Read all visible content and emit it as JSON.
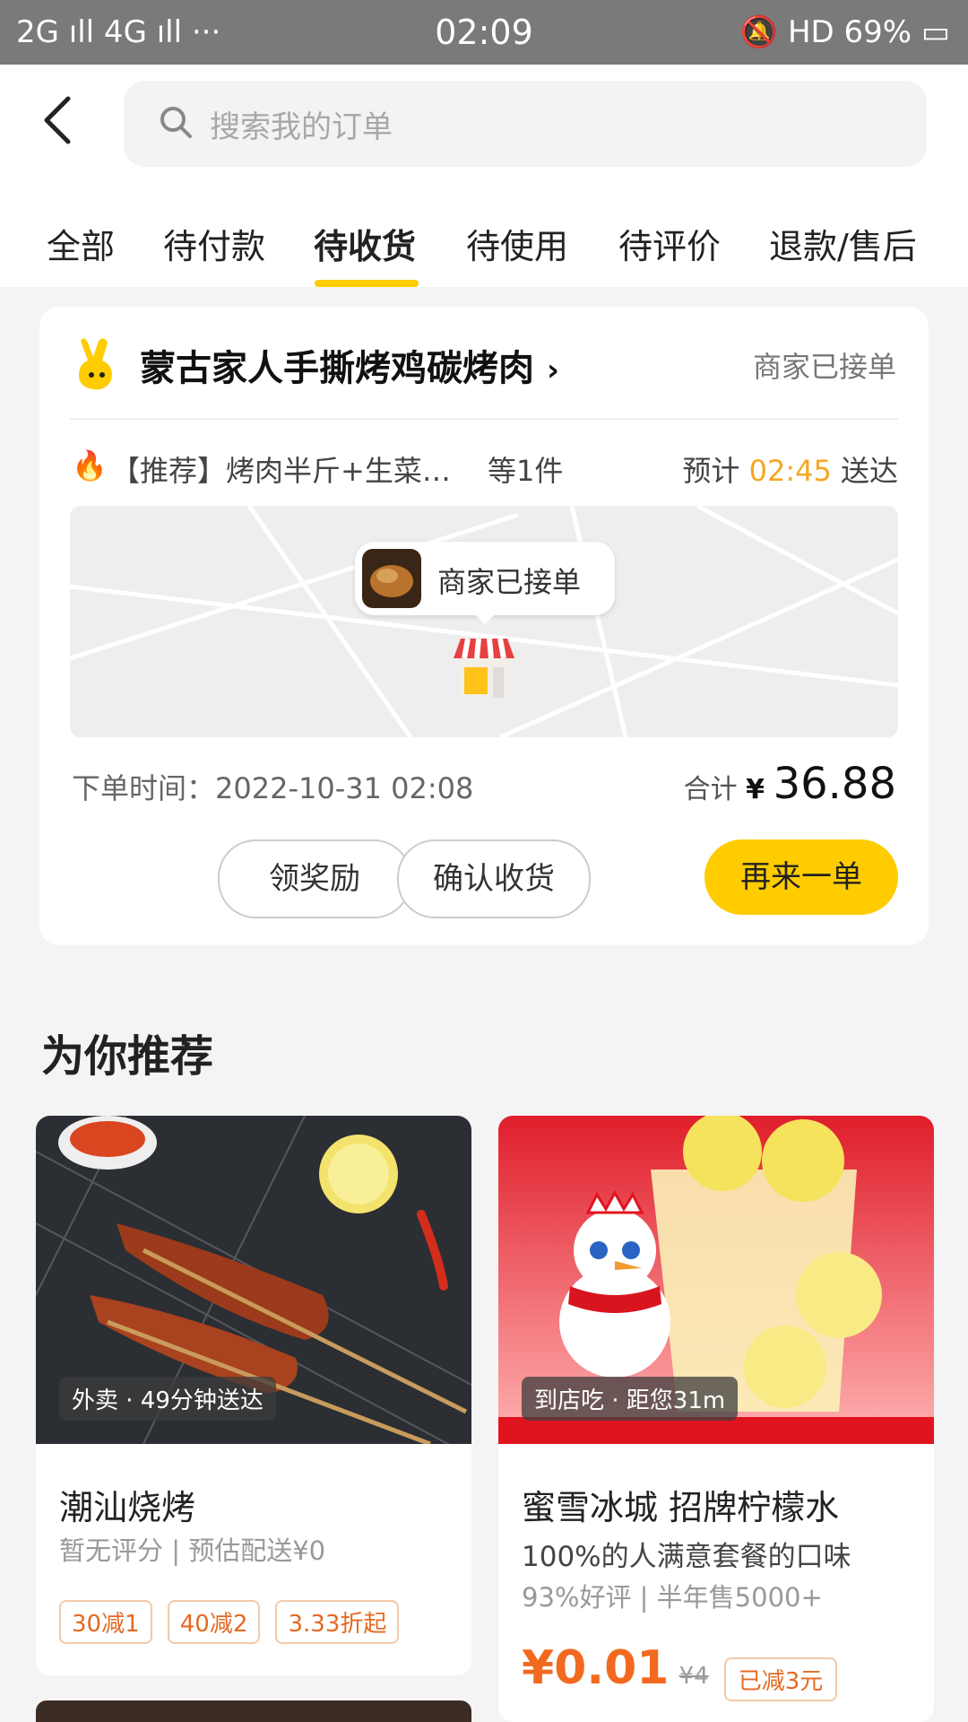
{
  "status_bar": {
    "left": "2G ıll 4G ıll ···",
    "time": "02:09",
    "right": "HD 69%"
  },
  "search": {
    "placeholder": "搜索我的订单"
  },
  "tabs": [
    {
      "label": "全部"
    },
    {
      "label": "待付款"
    },
    {
      "label": "待收货"
    },
    {
      "label": "待使用"
    },
    {
      "label": "待评价"
    },
    {
      "label": "退款/售后"
    }
  ],
  "order": {
    "shop_name": "蒙古家人手撕烤鸡碳烤肉",
    "status": "商家已接单",
    "items": "【推荐】烤肉半斤+生菜…",
    "count": "等1件",
    "eta_prefix": "预计",
    "eta_time": "02:45",
    "eta_suffix": "送达",
    "map_bubble": "商家已接单",
    "order_time": "下单时间：2022-10-31 02:08",
    "total_label": "合计",
    "currency": "¥",
    "total": "36.88",
    "buttons": {
      "reward": "领奖励",
      "confirm": "确认收货",
      "reorder": "再来一单"
    }
  },
  "recommend": {
    "title": "为你推荐",
    "items": [
      {
        "badge": "外卖 · 49分钟送达",
        "name": "潮汕烧烤",
        "sub": "暂无评分 | 预估配送¥0",
        "tags": [
          "30减1",
          "40减2",
          "3.33折起"
        ]
      },
      {
        "badge": "到店吃 · 距您31m",
        "name": "蜜雪冰城 招牌柠檬水",
        "desc": "100%的人满意套餐的口味",
        "sub": "93%好评 | 半年售5000+",
        "price": "¥0.01",
        "orig_price": "¥4",
        "discount": "已减3元"
      }
    ]
  },
  "colors": {
    "accent": "#ffcc00",
    "price": "#f26a20"
  }
}
